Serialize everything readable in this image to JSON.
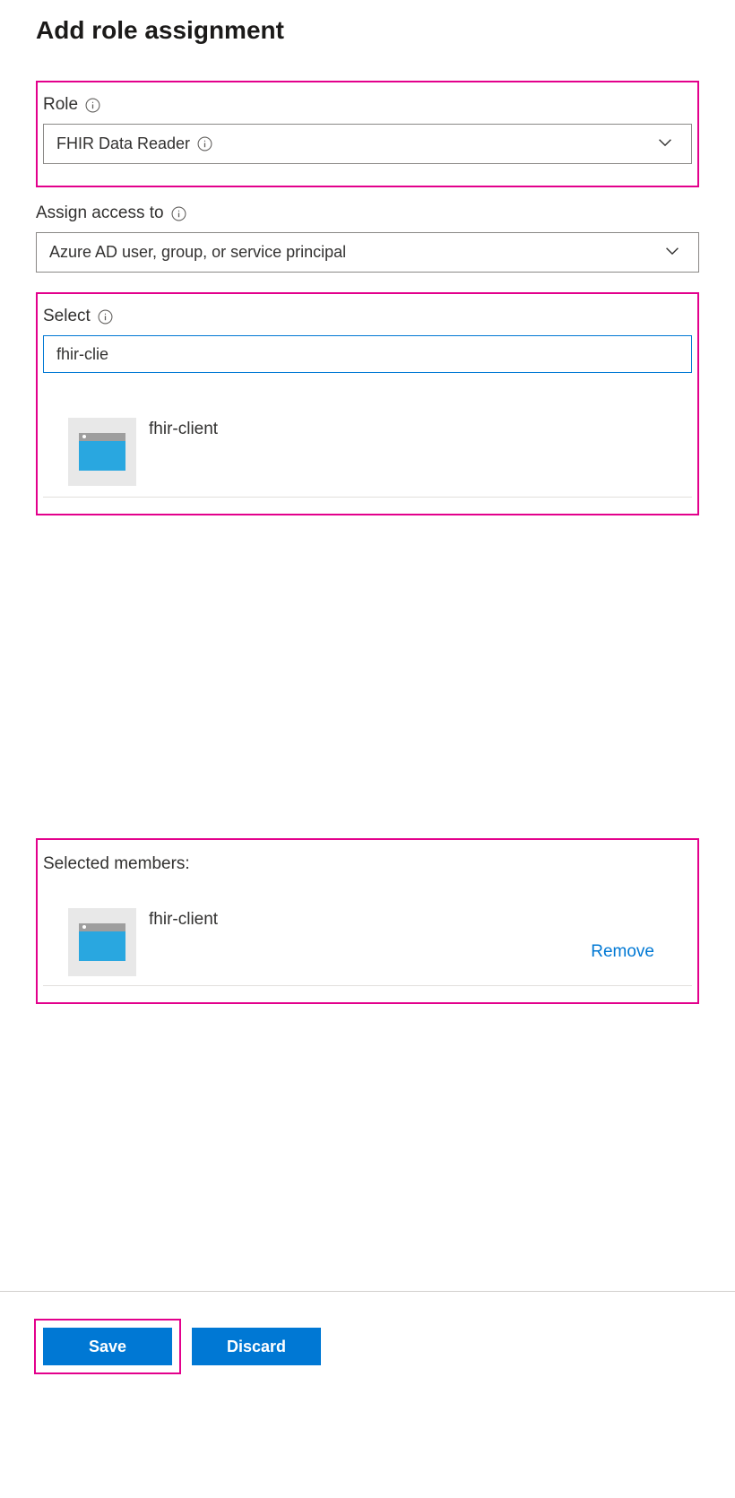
{
  "header": {
    "title": "Add role assignment"
  },
  "role": {
    "label": "Role",
    "value": "FHIR Data Reader"
  },
  "assign_access": {
    "label": "Assign access to",
    "value": "Azure AD user, group, or service principal"
  },
  "select": {
    "label": "Select",
    "input_value": "fhir-clie",
    "results": [
      {
        "name": "fhir-client",
        "icon": "app-icon"
      }
    ]
  },
  "selected_members": {
    "label": "Selected members:",
    "items": [
      {
        "name": "fhir-client",
        "icon": "app-icon",
        "remove_label": "Remove"
      }
    ]
  },
  "footer": {
    "save_label": "Save",
    "discard_label": "Discard"
  },
  "colors": {
    "highlight": "#e3008c",
    "primary": "#0078d4",
    "link": "#0078d4"
  }
}
